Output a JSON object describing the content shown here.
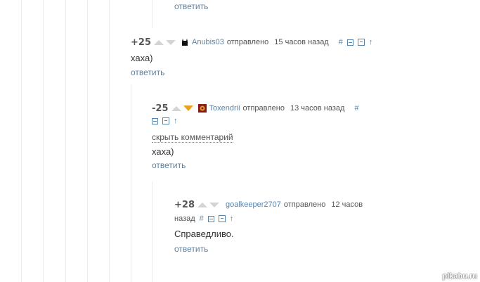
{
  "top_reply": {
    "reply_label": "ответить"
  },
  "comments": [
    {
      "rating": "+25",
      "username": "Anubis03",
      "sent_label": "отправлено",
      "time": "15 часов назад",
      "text": "хаха)",
      "reply_label": "ответить",
      "hash": "#",
      "arrow": "↑"
    },
    {
      "rating": "-25",
      "username": "Toxendrii",
      "sent_label": "отправлено",
      "time": "13 часов назад",
      "hide_label": "скрыть комментарий",
      "text": "хаха)",
      "reply_label": "ответить",
      "hash": "#",
      "arrow": "↑"
    },
    {
      "rating": "+28",
      "username": "goalkeeper2707",
      "sent_label": "отправлено",
      "time_line1": "12 часов",
      "time_line2": "назад",
      "text": "Справедливо.",
      "reply_label": "ответить",
      "hash": "#",
      "arrow": "↑"
    }
  ],
  "watermark": "pikabu.ru",
  "colors": {
    "link": "#5884a9",
    "downvote_active": "#e9a21d",
    "vote_inactive": "#d4d4d4"
  }
}
